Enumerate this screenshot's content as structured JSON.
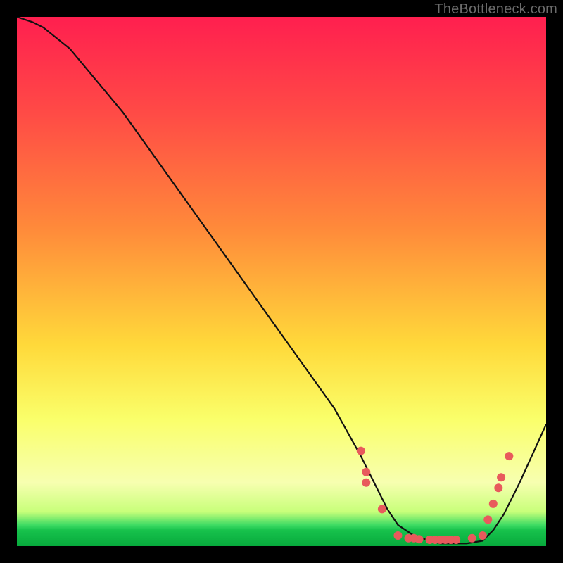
{
  "watermark": "TheBottleneck.com",
  "colors": {
    "curve_stroke": "#111",
    "marker_fill": "#e85a5c",
    "bg_black": "#000"
  },
  "chart_data": {
    "type": "line",
    "title": "",
    "xlabel": "",
    "ylabel": "",
    "xlim": [
      0,
      100
    ],
    "ylim": [
      0,
      100
    ],
    "grid": false,
    "series": [
      {
        "name": "bottleneck-curve",
        "x": [
          0,
          3,
          5,
          10,
          20,
          30,
          40,
          50,
          60,
          65,
          68,
          70,
          72,
          75,
          78,
          80,
          82,
          85,
          88,
          90,
          92,
          95,
          100
        ],
        "y": [
          100,
          99,
          98,
          94,
          82,
          68,
          54,
          40,
          26,
          17,
          11,
          7,
          4,
          2,
          1,
          0.5,
          0.5,
          0.5,
          1,
          3,
          6,
          12,
          23
        ]
      }
    ],
    "markers": [
      {
        "x": 65,
        "y": 18
      },
      {
        "x": 66,
        "y": 14
      },
      {
        "x": 66,
        "y": 12
      },
      {
        "x": 69,
        "y": 7
      },
      {
        "x": 72,
        "y": 2
      },
      {
        "x": 74,
        "y": 1.5
      },
      {
        "x": 75,
        "y": 1.5
      },
      {
        "x": 76,
        "y": 1.3
      },
      {
        "x": 78,
        "y": 1.2
      },
      {
        "x": 79,
        "y": 1.2
      },
      {
        "x": 80,
        "y": 1.2
      },
      {
        "x": 81,
        "y": 1.2
      },
      {
        "x": 82,
        "y": 1.2
      },
      {
        "x": 83,
        "y": 1.2
      },
      {
        "x": 86,
        "y": 1.5
      },
      {
        "x": 88,
        "y": 2
      },
      {
        "x": 89,
        "y": 5
      },
      {
        "x": 90,
        "y": 8
      },
      {
        "x": 91,
        "y": 11
      },
      {
        "x": 91.5,
        "y": 13
      },
      {
        "x": 93,
        "y": 17
      }
    ]
  }
}
